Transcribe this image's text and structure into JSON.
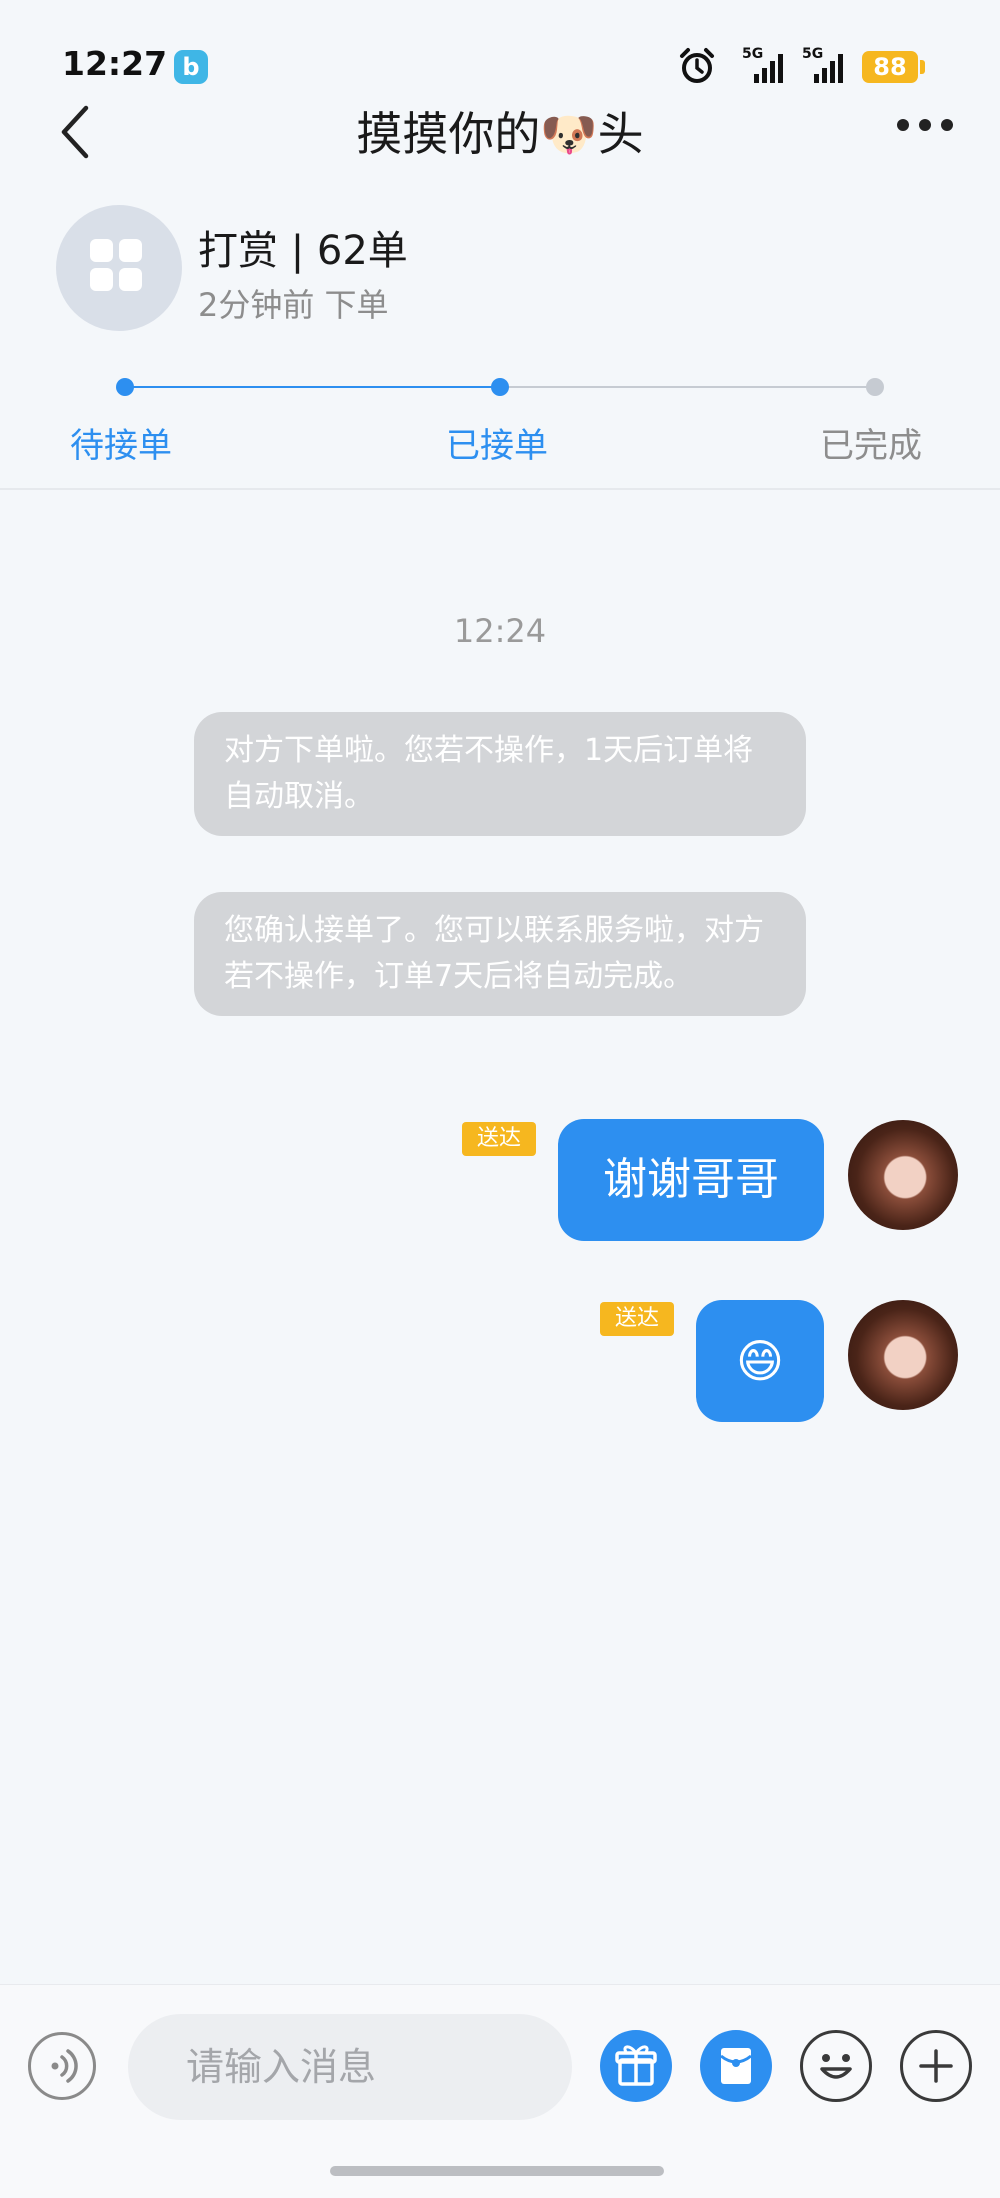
{
  "status_bar": {
    "time": "12:27",
    "app_badge": "b",
    "signal_labels": [
      "5G",
      "5G"
    ],
    "battery": "88",
    "icons": [
      "alarm-icon",
      "signal-icon",
      "battery-icon"
    ]
  },
  "header": {
    "title": "摸摸你的🐶头",
    "back_icon": "chevron-left-icon",
    "more_icon": "more-dots-icon"
  },
  "order": {
    "title": "打赏 | 62单",
    "subtitle": "2分钟前 下单"
  },
  "progress": {
    "steps": [
      {
        "label": "待接单",
        "state": "done"
      },
      {
        "label": "已接单",
        "state": "current"
      },
      {
        "label": "已完成",
        "state": "pending"
      }
    ]
  },
  "chat": {
    "timestamp": "12:24",
    "system_messages": [
      "对方下单啦。您若不操作，1天后订单将自动取消。",
      "您确认接单了。您可以联系服务啦，对方若不操作，订单7天后将自动完成。"
    ],
    "messages": [
      {
        "text": "谢谢哥哥",
        "status": "送达"
      },
      {
        "text": "😄",
        "status": "送达"
      }
    ]
  },
  "input_bar": {
    "placeholder": "请输入消息",
    "icons": [
      "voice-icon",
      "gift-icon",
      "red-packet-icon",
      "emoji-icon",
      "plus-icon"
    ]
  },
  "colors": {
    "accent": "#2d8ff0",
    "badge": "#f6b71f",
    "system_bubble": "#d3d5d8"
  }
}
